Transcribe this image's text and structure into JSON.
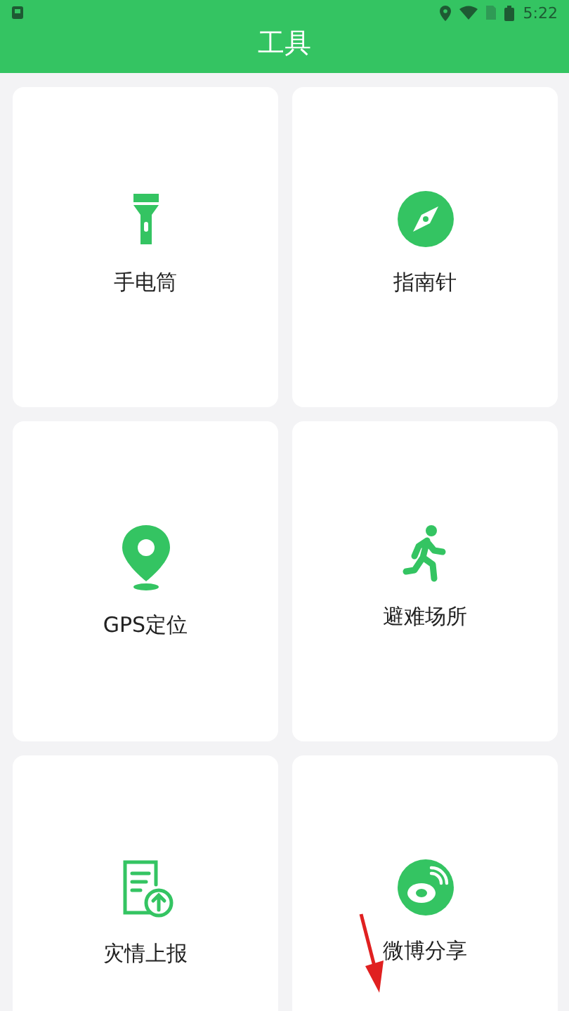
{
  "status_bar": {
    "time": "5:22"
  },
  "header": {
    "title": "工具"
  },
  "tools": [
    {
      "label": "手电筒",
      "kind": "flashlight"
    },
    {
      "label": "指南针",
      "kind": "compass"
    },
    {
      "label": "GPS定位",
      "kind": "pin"
    },
    {
      "label": "避难场所",
      "kind": "runner"
    },
    {
      "label": "灾情上报",
      "kind": "upload"
    },
    {
      "label": "微博分享",
      "kind": "weibo"
    }
  ]
}
